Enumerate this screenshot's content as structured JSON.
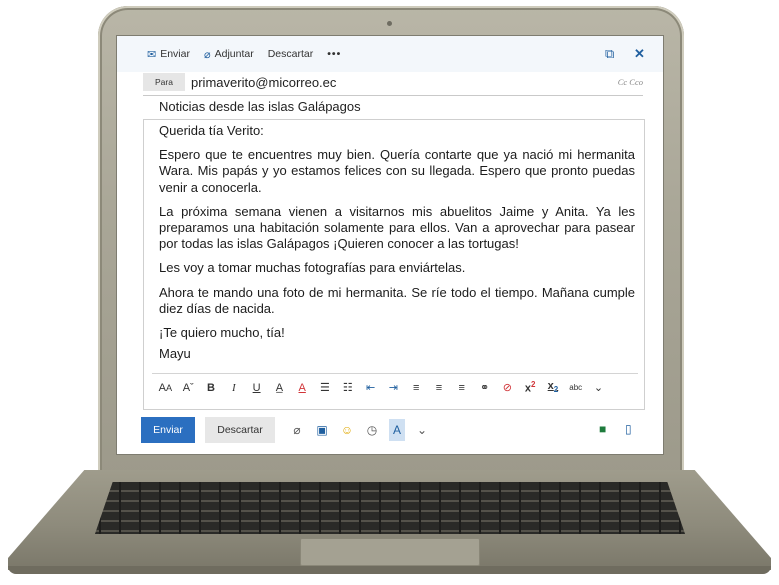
{
  "toolbar": {
    "send_label": "Enviar",
    "attach_label": "Adjuntar",
    "discard_label": "Descartar",
    "more_label": "•••",
    "send_icon": "envelope-icon",
    "attach_icon": "paperclip-icon",
    "popout_icon": "popout-icon",
    "close_icon": "close-icon"
  },
  "recipient": {
    "to_label": "Para",
    "to_value": "primaverito@micorreo.ec",
    "cc_label": "Cc  Cco"
  },
  "subject": "Noticias desde las islas Galápagos",
  "message": {
    "greeting": "Querida tía Verito:",
    "p1": "Espero que te encuentres muy bien. Quería contarte que ya nació mi hermanita Wara. Mis papás y yo estamos felices con su llegada. Espero que pronto puedas venir a conocerla.",
    "p2": "La próxima semana vienen a visitarnos mis abuelitos Jaime y Anita. Ya les preparamos una habitación solamente para ellos. Van a aprovechar para pasear por todas las islas Galápagos ¡Quieren conocer a las tortugas!",
    "p3": "Les voy a tomar muchas fotografías para enviártelas.",
    "p4": "Ahora te mando una foto de mi hermanita. Se ríe todo el tiempo. Mañana cumple diez días de nacida.",
    "p5": "¡Te quiero mucho, tía!",
    "signature": "Mayu"
  },
  "format_toolbar": [
    "A͟A",
    "Aˇ",
    "B",
    "I",
    "U",
    "A",
    "A",
    "☰",
    "☷",
    "⇤",
    "⇥",
    "≡",
    "≡",
    "≡",
    "⚭",
    "⊘",
    "x²",
    "x₂",
    "abc",
    "⌄"
  ],
  "actions": {
    "send_label": "Enviar",
    "discard_label": "Descartar"
  },
  "colors": {
    "accent": "#2b6fc0",
    "toolbar_bg": "#f3f7fb",
    "laptop_body": "#a9a697"
  }
}
